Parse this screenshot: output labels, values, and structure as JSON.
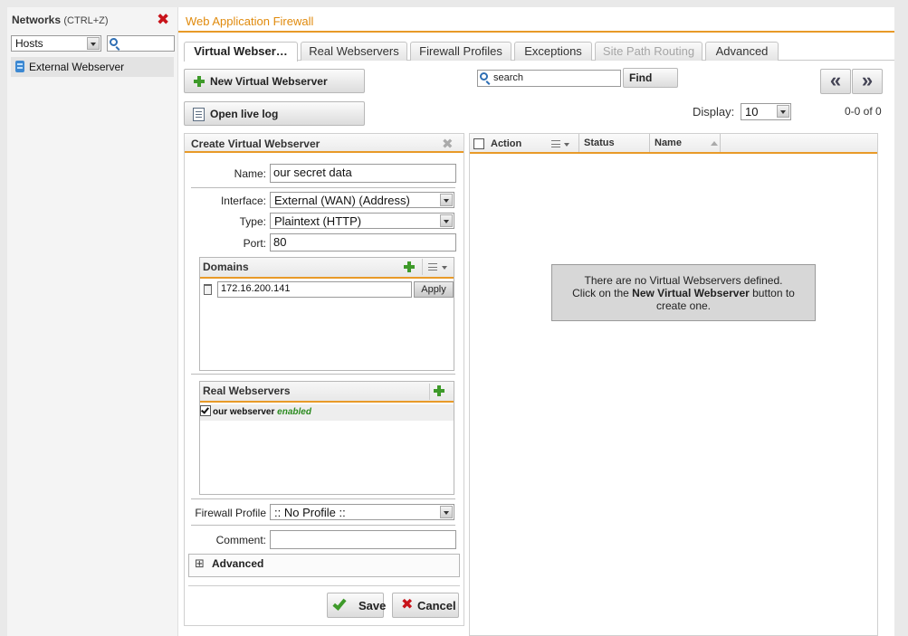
{
  "left_panel": {
    "title": "Networks",
    "shortcut": "(CTRL+Z)",
    "filter_select": "Hosts",
    "search_value": "",
    "items": [
      {
        "label": "External Webserver"
      }
    ]
  },
  "app": {
    "title": "Web Application Firewall"
  },
  "tabs": [
    {
      "label": "Virtual Webser…",
      "state": "active"
    },
    {
      "label": "Real Webservers",
      "state": "normal"
    },
    {
      "label": "Firewall Profiles",
      "state": "normal"
    },
    {
      "label": "Exceptions",
      "state": "normal"
    },
    {
      "label": "Site Path Routing",
      "state": "disabled"
    },
    {
      "label": "Advanced",
      "state": "normal"
    }
  ],
  "toolbar": {
    "new_button": "New Virtual Webserver",
    "log_button": "Open live log",
    "search_placeholder": "search",
    "find_button": "Find",
    "prev_button": "«",
    "next_button": "»",
    "display_label": "Display:",
    "display_value": "10",
    "count": "0-0 of 0"
  },
  "form": {
    "title": "Create Virtual Webserver",
    "close": "✖",
    "name_label": "Name:",
    "name_value": "our secret data",
    "interface_label": "Interface:",
    "interface_value": "External (WAN) (Address)",
    "type_label": "Type:",
    "type_value": "Plaintext (HTTP)",
    "port_label": "Port:",
    "port_value": "80",
    "domains": {
      "title": "Domains",
      "entries": [
        {
          "value": "172.16.200.141",
          "apply": "Apply"
        }
      ]
    },
    "real_webservers": {
      "title": "Real Webservers",
      "entries": [
        {
          "name": "our webserver",
          "status": "enabled",
          "checked": true
        }
      ]
    },
    "firewall_profile_label": "Firewall Profile",
    "firewall_profile_value": ":: No Profile ::",
    "comment_label": "Comment:",
    "comment_value": "",
    "advanced_toggle": "⊞",
    "advanced_label": "Advanced",
    "save_button": "Save",
    "cancel_button": "Cancel"
  },
  "table": {
    "columns": [
      "Action",
      "Status",
      "Name"
    ],
    "empty_line1": "There are no Virtual Webservers defined.",
    "empty_line2_prefix": "Click on the ",
    "empty_line2_bold": "New Virtual Webserver",
    "empty_line2_suffix": " button to",
    "empty_line3": "create one."
  },
  "colors": {
    "accent_orange": "#e89a28",
    "title_orange": "#e08a0c",
    "add_green": "#3e9a2a",
    "close_red": "#c8131a",
    "enabled_green": "#2a8a1e"
  },
  "icons": [
    "close-icon",
    "search-icon",
    "plus-icon",
    "log-icon",
    "menu-icon",
    "trash-icon",
    "check-icon",
    "x-icon",
    "expand-icon",
    "host-icon"
  ]
}
